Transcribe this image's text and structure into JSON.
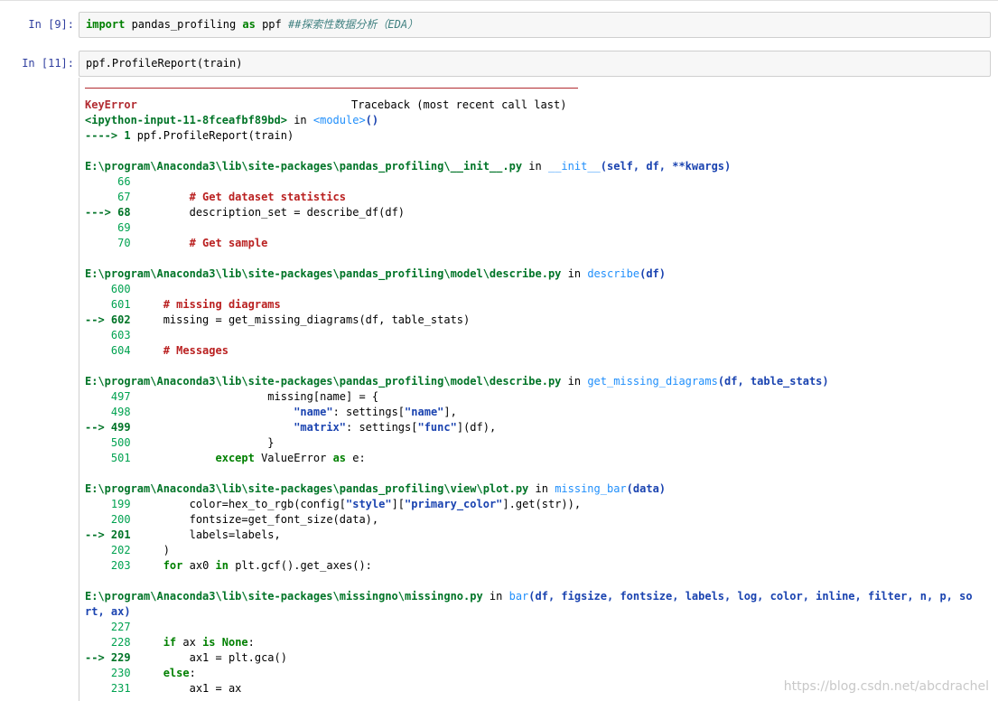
{
  "cells": [
    {
      "prompt": "In  [9]:",
      "code": "import pandas_profiling as ppf ##探索性数据分析（EDA）"
    },
    {
      "prompt": "In  [11]:",
      "code": "ppf.ProfileReport(train)"
    }
  ],
  "traceback": {
    "header_left": "KeyError",
    "header_right": "Traceback (most recent call last)",
    "lines": [
      {
        "t": "<ipython-input-11-8fceafbf89bd> in <module>()"
      },
      {
        "t": "----> 1 ppf.ProfileReport(train)"
      },
      {
        "t": ""
      },
      {
        "t": "E:\\program\\Anaconda3\\lib\\site-packages\\pandas_profiling\\__init__.py in __init__(self, df, **kwargs)"
      },
      {
        "t": "     66"
      },
      {
        "t": "     67         # Get dataset statistics"
      },
      {
        "t": "---> 68         description_set = describe_df(df)"
      },
      {
        "t": "     69"
      },
      {
        "t": "     70         # Get sample"
      },
      {
        "t": ""
      },
      {
        "t": "E:\\program\\Anaconda3\\lib\\site-packages\\pandas_profiling\\model\\describe.py in describe(df)"
      },
      {
        "t": "    600"
      },
      {
        "t": "    601     # missing diagrams"
      },
      {
        "t": "--> 602     missing = get_missing_diagrams(df, table_stats)"
      },
      {
        "t": "    603"
      },
      {
        "t": "    604     # Messages"
      },
      {
        "t": ""
      },
      {
        "t": "E:\\program\\Anaconda3\\lib\\site-packages\\pandas_profiling\\model\\describe.py in get_missing_diagrams(df, table_stats)"
      },
      {
        "t": "    497                     missing[name] = {"
      },
      {
        "t": "    498                         \"name\": settings[\"name\"],"
      },
      {
        "t": "--> 499                         \"matrix\": settings[\"func\"](df),"
      },
      {
        "t": "    500                     }"
      },
      {
        "t": "    501             except ValueError as e:"
      },
      {
        "t": ""
      },
      {
        "t": "E:\\program\\Anaconda3\\lib\\site-packages\\pandas_profiling\\view\\plot.py in missing_bar(data)"
      },
      {
        "t": "    199         color=hex_to_rgb(config[\"style\"][\"primary_color\"].get(str)),"
      },
      {
        "t": "    200         fontsize=get_font_size(data),"
      },
      {
        "t": "--> 201         labels=labels,"
      },
      {
        "t": "    202     )"
      },
      {
        "t": "    203     for ax0 in plt.gcf().get_axes():"
      },
      {
        "t": ""
      },
      {
        "t": "E:\\program\\Anaconda3\\lib\\site-packages\\missingno\\missingno.py in bar(df, figsize, fontsize, labels, log, color, inline, filter, n, p, so"
      },
      {
        "t": "rt, ax)"
      },
      {
        "t": "    227"
      },
      {
        "t": "    228     if ax is None:"
      },
      {
        "t": "--> 229         ax1 = plt.gca()"
      },
      {
        "t": "    230     else:"
      },
      {
        "t": "    231         ax1 = ax"
      }
    ]
  },
  "watermark": "https://blog.csdn.net/abcdrachel"
}
